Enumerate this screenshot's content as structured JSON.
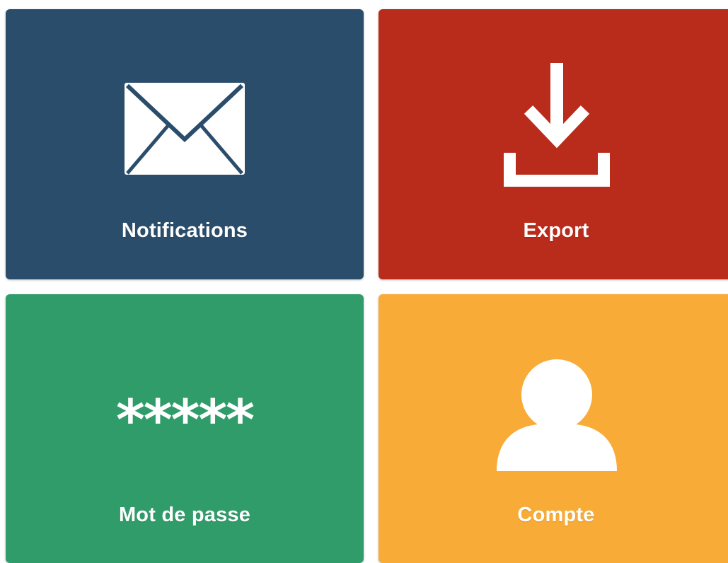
{
  "tiles": {
    "notifications": {
      "label": "Notifications",
      "icon": "envelope-icon",
      "color": "#2a4d6c"
    },
    "export": {
      "label": "Export",
      "icon": "download-icon",
      "color": "#b92b1b"
    },
    "password": {
      "label": "Mot de passe",
      "stars": "*****",
      "color": "#2f9c69"
    },
    "account": {
      "label": "Compte",
      "icon": "user-icon",
      "color": "#f8ab36"
    }
  }
}
